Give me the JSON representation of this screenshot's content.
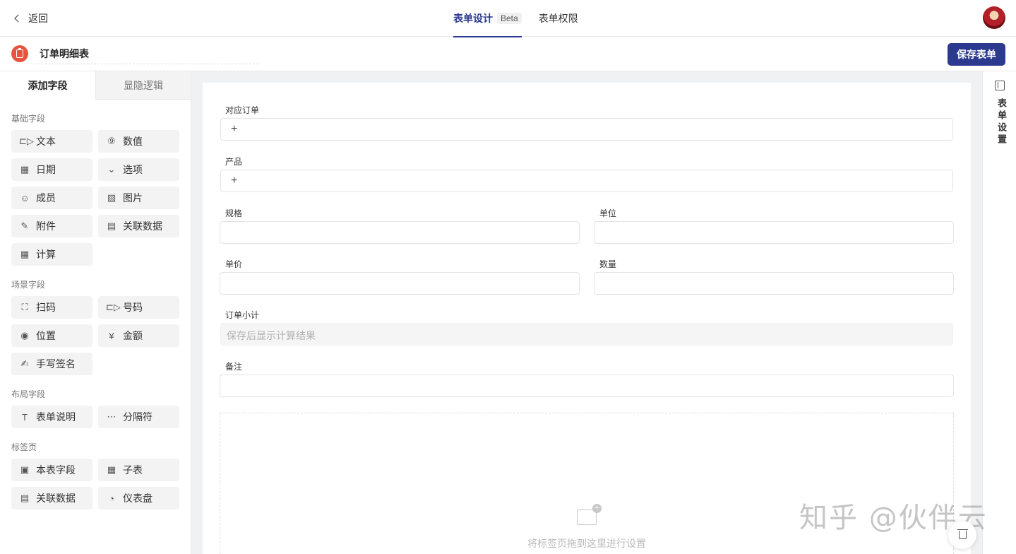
{
  "header": {
    "back_label": "返回",
    "tabs": [
      {
        "label": "表单设计",
        "badge": "Beta",
        "active": true
      },
      {
        "label": "表单权限",
        "active": false
      }
    ]
  },
  "titlebar": {
    "form_name": "订单明细表",
    "save_label": "保存表单"
  },
  "sidebar": {
    "tabs": [
      {
        "label": "添加字段",
        "active": true
      },
      {
        "label": "显隐逻辑",
        "active": false
      }
    ],
    "groups": [
      {
        "title": "基础字段",
        "items": [
          {
            "label": "文本",
            "icon": "text-field-icon",
            "glyph": "⊏▷"
          },
          {
            "label": "数值",
            "icon": "number-icon",
            "glyph": "⑨"
          },
          {
            "label": "日期",
            "icon": "calendar-icon",
            "glyph": "▦"
          },
          {
            "label": "选项",
            "icon": "option-icon",
            "glyph": "⌄"
          },
          {
            "label": "成员",
            "icon": "member-icon",
            "glyph": "☺"
          },
          {
            "label": "图片",
            "icon": "image-icon",
            "glyph": "▨"
          },
          {
            "label": "附件",
            "icon": "attachment-icon",
            "glyph": "✎"
          },
          {
            "label": "关联数据",
            "icon": "linked-data-icon",
            "glyph": "▤"
          },
          {
            "label": "计算",
            "icon": "calculator-icon",
            "glyph": "▦"
          }
        ]
      },
      {
        "title": "场景字段",
        "items": [
          {
            "label": "扫码",
            "icon": "scan-icon",
            "glyph": "⛶"
          },
          {
            "label": "号码",
            "icon": "serial-number-icon",
            "glyph": "⊏▷"
          },
          {
            "label": "位置",
            "icon": "location-icon",
            "glyph": "◉"
          },
          {
            "label": "金额",
            "icon": "currency-icon",
            "glyph": "¥"
          },
          {
            "label": "手写签名",
            "icon": "signature-icon",
            "glyph": "✍"
          }
        ]
      },
      {
        "title": "布局字段",
        "items": [
          {
            "label": "表单说明",
            "icon": "text-t-icon",
            "glyph": "T"
          },
          {
            "label": "分隔符",
            "icon": "divider-icon",
            "glyph": "⋯"
          }
        ]
      },
      {
        "title": "标签页",
        "items": [
          {
            "label": "本表字段",
            "icon": "table-field-icon",
            "glyph": "▣"
          },
          {
            "label": "子表",
            "icon": "subtable-icon",
            "glyph": "▦"
          },
          {
            "label": "关联数据",
            "icon": "linked-data-icon",
            "glyph": "▤"
          },
          {
            "label": "仪表盘",
            "icon": "dashboard-icon",
            "glyph": "◔"
          }
        ]
      }
    ]
  },
  "form": {
    "fields": {
      "order": {
        "label": "对应订单",
        "button": "+"
      },
      "product": {
        "label": "产品",
        "button": "+"
      },
      "spec": {
        "label": "规格"
      },
      "unit": {
        "label": "单位"
      },
      "price": {
        "label": "单价"
      },
      "quantity": {
        "label": "数量"
      },
      "subtotal": {
        "label": "订单小计",
        "placeholder": "保存后显示计算结果"
      },
      "remark": {
        "label": "备注"
      }
    },
    "dropzone_text": "将标签页拖到这里进行设置"
  },
  "settings_rail": {
    "label": "表单设置"
  },
  "watermark": "知乎 @伙伴云"
}
